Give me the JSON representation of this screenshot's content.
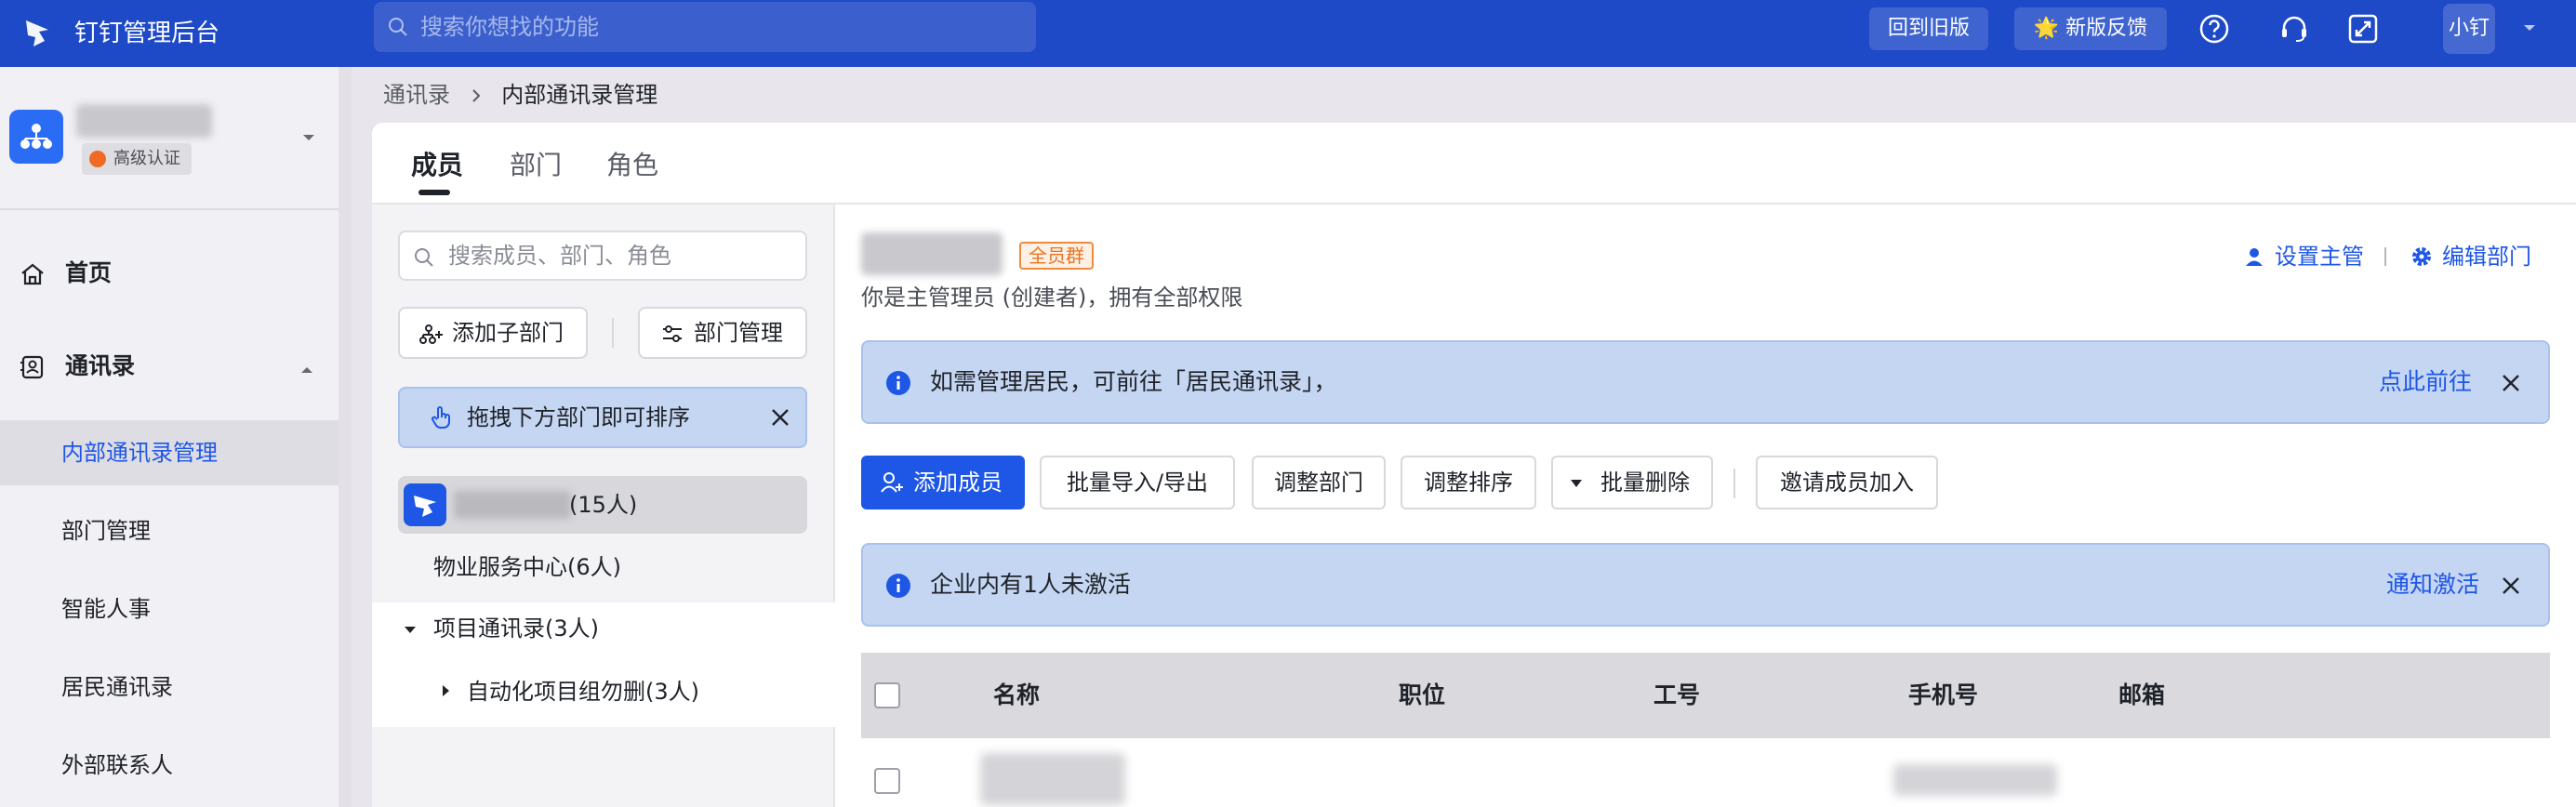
{
  "topbar": {
    "app_title": "钉钉管理后台",
    "search_placeholder": "搜索你想找的功能",
    "back_old_label": "回到旧版",
    "feedback_label": "🌟 新版反馈",
    "user_label": "小钉",
    "icons": [
      "logo-icon",
      "search-icon",
      "help-icon",
      "support-icon",
      "fullscreen-icon",
      "chevron-down-icon"
    ]
  },
  "sidebar": {
    "cert_label": "高级认证",
    "nav": {
      "home": "首页",
      "contacts": "通讯录"
    },
    "sub_items": [
      "内部通讯录管理",
      "部门管理",
      "智能人事",
      "居民通讯录",
      "外部联系人"
    ],
    "active_index": 0
  },
  "breadcrumb": {
    "parent": "通讯录",
    "current": "内部通讯录管理"
  },
  "tabs": [
    "成员",
    "部门",
    "角色"
  ],
  "left_panel": {
    "search_placeholder": "搜索成员、部门、角色",
    "add_sub_dept": "添加子部门",
    "dept_manage": "部门管理",
    "sort_tip": "拖拽下方部门即可排序",
    "root_count": "(15人)",
    "tree": {
      "item1": "物业服务中心(6人)",
      "item2": "项目通讯录(3人)",
      "item3": "自动化项目组勿删(3人)"
    }
  },
  "right_panel": {
    "tag": "全员群",
    "perm_text": "你是主管理员 (创建者)，拥有全部权限",
    "set_manager": "设置主管",
    "edit_dept": "编辑部门",
    "info1": {
      "message": "如需管理居民，可前往「居民通讯录」，",
      "action": "点此前往"
    },
    "info2": {
      "message": "企业内有1人未激活",
      "action": "通知激活"
    },
    "buttons": {
      "add_member": "添加成员",
      "batch_io": "批量导入/导出",
      "adjust_dept": "调整部门",
      "adjust_sort": "调整排序",
      "batch_delete": "批量删除",
      "invite": "邀请成员加入"
    },
    "table_headers": [
      "名称",
      "职位",
      "工号",
      "手机号",
      "邮箱"
    ]
  },
  "colors": {
    "brand": "#1e49c7",
    "primary": "#1e56e6",
    "info_bg": "#c5d6f3",
    "warning_tag": "#e9731f"
  }
}
